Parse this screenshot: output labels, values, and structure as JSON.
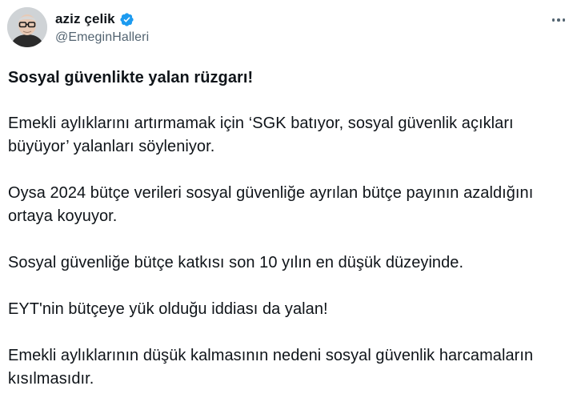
{
  "author": {
    "display_name": "aziz çelik",
    "handle": "@EmeginHalleri",
    "verified": true,
    "avatar_icon": "person-with-glasses-avatar",
    "verified_icon": "verified-badge-icon",
    "more_icon": "more-options-icon"
  },
  "colors": {
    "verified_blue": "#1d9bf0",
    "text_primary": "#0f1419",
    "text_secondary": "#536471"
  },
  "tweet": {
    "headline": "Sosyal güvenlikte yalan rüzgarı!",
    "paragraphs": [
      "Emekli aylıklarını artırmamak için ‘SGK batıyor, sosyal güvenlik açıkları büyüyor’ yalanları söyleniyor.",
      "Oysa 2024 bütçe verileri sosyal güvenliğe ayrılan bütçe payının azaldığını ortaya koyuyor.",
      "Sosyal güvenliğe bütçe katkısı son 10 yılın en düşük düzeyinde.",
      "EYT'nin bütçeye yük olduğu iddiası da yalan!",
      "Emekli aylıklarının düşük kalmasının nedeni sosyal güvenlik harcamaların kısılmasıdır."
    ]
  }
}
